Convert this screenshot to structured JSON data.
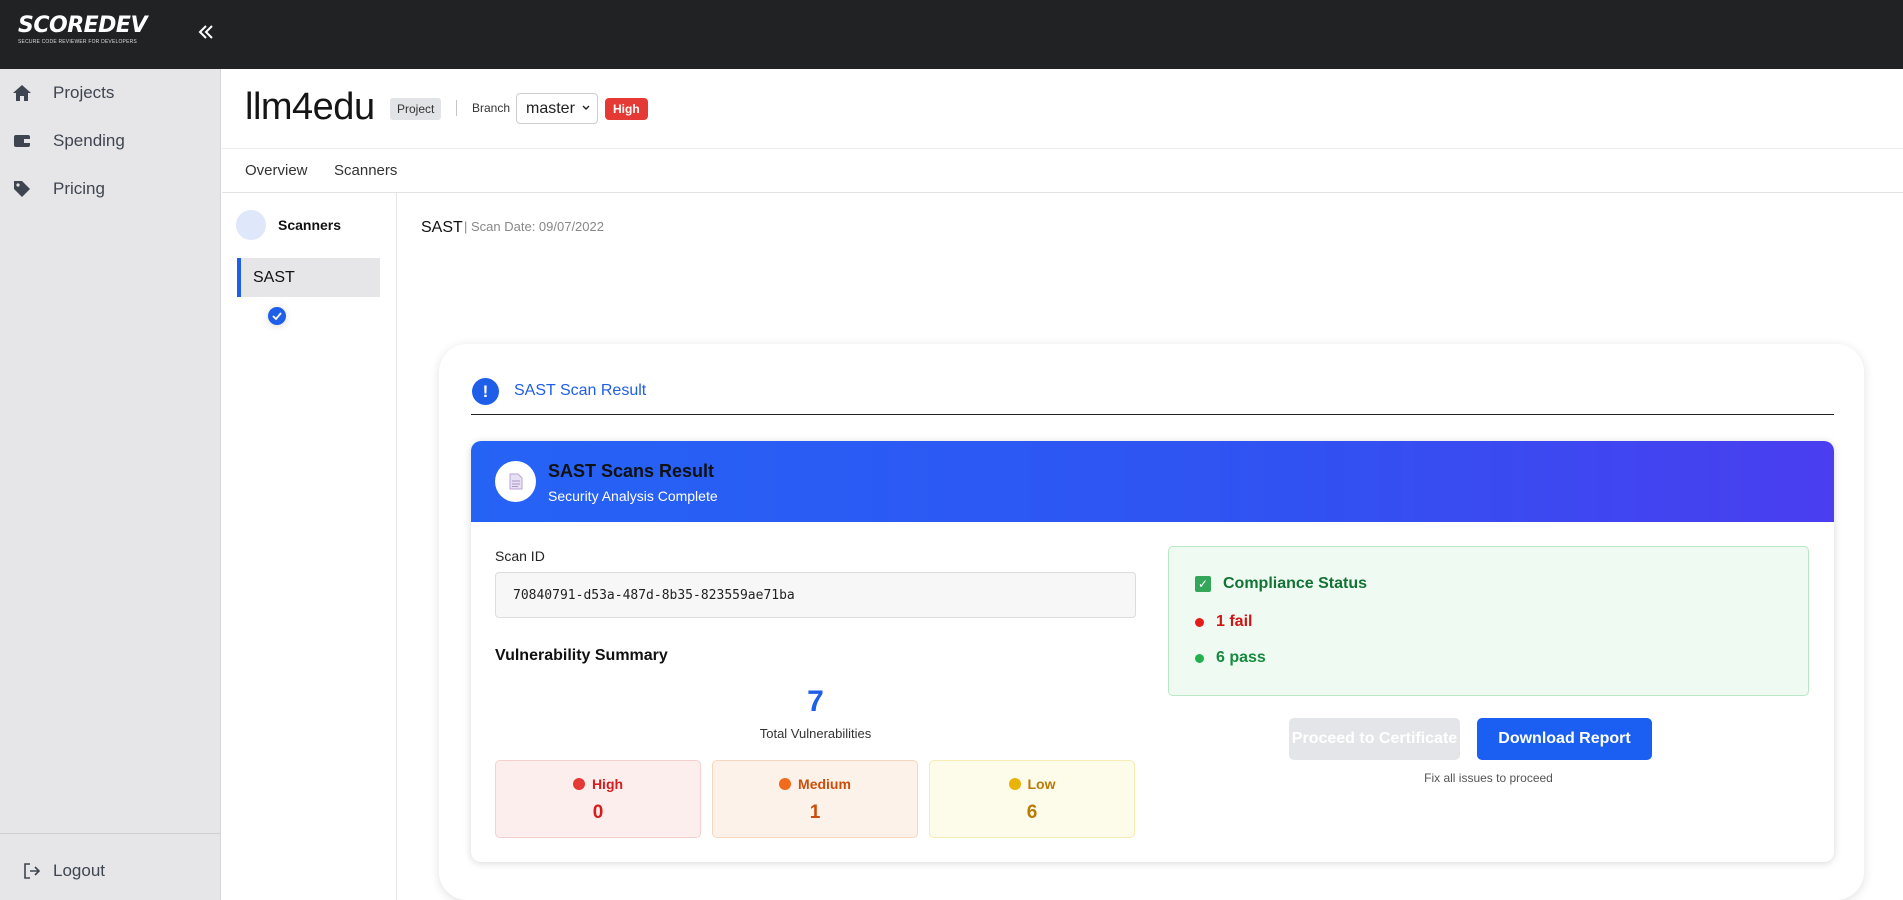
{
  "app": {
    "logo_text": "SCOREDEV",
    "logo_tagline": "SECURE CODE REVIEWER FOR DEVELOPERS"
  },
  "sidebar": {
    "items": [
      {
        "label": "Projects",
        "icon": "home-icon"
      },
      {
        "label": "Spending",
        "icon": "wallet-icon"
      },
      {
        "label": "Pricing",
        "icon": "tag-icon"
      }
    ],
    "logout_label": "Logout"
  },
  "header": {
    "project_name": "llm4edu",
    "project_badge": "Project",
    "branch_label": "Branch",
    "branch_value": "master",
    "severity_badge": "High"
  },
  "tabs": [
    {
      "label": "Overview"
    },
    {
      "label": "Scanners"
    }
  ],
  "scanners_panel": {
    "heading": "Scanners",
    "items": [
      {
        "label": "SAST"
      }
    ]
  },
  "main": {
    "title": "SAST",
    "scan_date": "| Scan Date: 09/07/2022",
    "card_title": "SAST Scan Result",
    "banner_title": "SAST Scans Result",
    "banner_subtitle": "Security Analysis Complete",
    "scan_id_label": "Scan ID",
    "scan_id_value": "70840791-d53a-487d-8b35-823559ae71ba",
    "vuln_summary_title": "Vulnerability Summary",
    "total_count": "7",
    "total_label": "Total Vulnerabilities",
    "severities": [
      {
        "name": "High",
        "count": "0",
        "color": "#e53935"
      },
      {
        "name": "Medium",
        "count": "1",
        "color": "#f26b1d"
      },
      {
        "name": "Low",
        "count": "6",
        "color": "#eab308"
      }
    ],
    "compliance": {
      "title": "Compliance Status",
      "fail_text": "1 fail",
      "pass_text": "6 pass"
    },
    "proceed_button": "Proceed to Certificate",
    "download_button": "Download Report",
    "fix_note": "Fix all issues to proceed"
  },
  "colors": {
    "accent": "#1f5ee8",
    "topbar": "#202224",
    "sidebar": "#e6e6e8"
  }
}
